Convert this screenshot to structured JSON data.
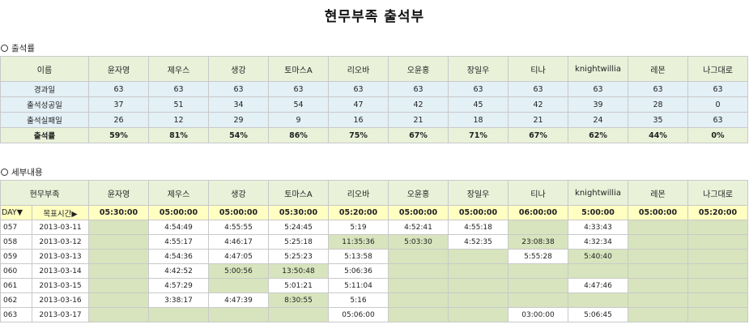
{
  "title": "현무부족 출석부",
  "section1": "출석률",
  "section2": "세부내용",
  "members": [
    "윤자영",
    "제우스",
    "생강",
    "토마스A",
    "리오바",
    "오윤홍",
    "장일우",
    "티나",
    "knightwillia",
    "레몬",
    "나그대로"
  ],
  "summary": {
    "name_header": "이름",
    "rows": [
      {
        "label": "경과일",
        "values": [
          "63",
          "63",
          "63",
          "63",
          "63",
          "63",
          "63",
          "63",
          "63",
          "63",
          "63"
        ]
      },
      {
        "label": "출석성공일",
        "values": [
          "37",
          "51",
          "34",
          "54",
          "47",
          "42",
          "45",
          "42",
          "39",
          "28",
          "0"
        ]
      },
      {
        "label": "출석실패일",
        "values": [
          "26",
          "12",
          "29",
          "9",
          "16",
          "21",
          "18",
          "21",
          "24",
          "35",
          "63"
        ]
      },
      {
        "label": "출석률",
        "values": [
          "59%",
          "81%",
          "54%",
          "86%",
          "75%",
          "67%",
          "71%",
          "67%",
          "62%",
          "44%",
          "0%"
        ]
      }
    ]
  },
  "detail": {
    "group_header": "현무부족",
    "day_label": "DAY▼",
    "target_label": "목표시간▶",
    "targets": [
      "05:30:00",
      "05:00:00",
      "05:00:00",
      "05:30:00",
      "05:20:00",
      "05:00:00",
      "05:00:00",
      "06:00:00",
      "5:00:00",
      "05:00:00",
      "05:20:00"
    ],
    "rows": [
      {
        "day": "057",
        "date": "2013-03-11",
        "times": [
          "",
          "4:54:49",
          "4:55:55",
          "5:24:45",
          "5:19",
          "4:52:41",
          "4:55:18",
          "",
          "4:33:43",
          "",
          ""
        ],
        "green": [
          true,
          false,
          false,
          false,
          false,
          false,
          false,
          true,
          false,
          true,
          true
        ]
      },
      {
        "day": "058",
        "date": "2013-03-12",
        "times": [
          "",
          "4:55:17",
          "4:46:17",
          "5:25:18",
          "11:35:36",
          "5:03:30",
          "4:52:35",
          "23:08:38",
          "4:32:34",
          "",
          ""
        ],
        "green": [
          true,
          false,
          false,
          false,
          true,
          true,
          false,
          true,
          false,
          true,
          true
        ]
      },
      {
        "day": "059",
        "date": "2013-03-13",
        "times": [
          "",
          "4:54:36",
          "4:47:05",
          "5:25:23",
          "5:13:58",
          "",
          "",
          "5:55:28",
          "5:40:40",
          "",
          ""
        ],
        "green": [
          true,
          false,
          false,
          false,
          false,
          true,
          true,
          false,
          true,
          true,
          true
        ]
      },
      {
        "day": "060",
        "date": "2013-03-14",
        "times": [
          "",
          "4:42:52",
          "5:00:56",
          "13:50:48",
          "5:06:36",
          "",
          "",
          "",
          "",
          "",
          ""
        ],
        "green": [
          true,
          false,
          true,
          true,
          false,
          true,
          true,
          true,
          true,
          true,
          true
        ]
      },
      {
        "day": "061",
        "date": "2013-03-15",
        "times": [
          "",
          "4:57:29",
          "",
          "5:01:21",
          "5:11:04",
          "",
          "",
          "",
          "4:47:46",
          "",
          ""
        ],
        "green": [
          true,
          false,
          true,
          false,
          false,
          true,
          true,
          true,
          false,
          true,
          true
        ]
      },
      {
        "day": "062",
        "date": "2013-03-16",
        "times": [
          "",
          "3:38:17",
          "4:47:39",
          "8:30:55",
          "5:16",
          "",
          "",
          "",
          "",
          "",
          ""
        ],
        "green": [
          true,
          false,
          false,
          true,
          false,
          true,
          true,
          true,
          true,
          true,
          true
        ]
      },
      {
        "day": "063",
        "date": "2013-03-17",
        "times": [
          "",
          "",
          "",
          "",
          "05:06:00",
          "",
          "",
          "03:00:00",
          "5:06:45",
          "",
          ""
        ],
        "green": [
          true,
          true,
          true,
          true,
          false,
          true,
          true,
          false,
          false,
          true,
          true
        ]
      }
    ]
  }
}
